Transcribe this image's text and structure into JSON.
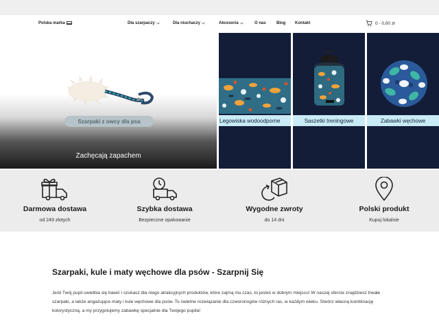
{
  "header": {
    "logo": "Polska marka",
    "nav": [
      {
        "label": "Dla szarpaczy",
        "has_dropdown": true
      },
      {
        "label": "Dla niuchaczy",
        "has_dropdown": true
      },
      {
        "label": "Akcesoria",
        "has_dropdown": true
      },
      {
        "label": "O nas",
        "has_dropdown": false
      },
      {
        "label": "Blog",
        "has_dropdown": false
      },
      {
        "label": "Kontakt",
        "has_dropdown": false
      }
    ],
    "cart_text": "0 - 0,00 zł"
  },
  "hero": {
    "pill_label": "Szarpaki z owcy dla psa",
    "caption": "Zachęcają zapachem"
  },
  "tiles": [
    {
      "label": "Legowiska wodoodporne"
    },
    {
      "label": "Saszetki treningowe"
    },
    {
      "label": "Zabawki węchowe"
    }
  ],
  "features": [
    {
      "title": "Darmowa dostawa",
      "subtitle": "od 249 złotych",
      "icon": "gift-truck-icon"
    },
    {
      "title": "Szybka dostawa",
      "subtitle": "Bezpieczne opakowanie",
      "icon": "fast-truck-icon"
    },
    {
      "title": "Wygodne zwroty",
      "subtitle": "do 14 dni",
      "icon": "return-box-icon"
    },
    {
      "title": "Polski produkt",
      "subtitle": "Kupuj lokalnie",
      "icon": "location-pin-icon"
    }
  ],
  "content": {
    "title": "Szarpaki, kule i maty węchowe dla psów - Szarpnij Się",
    "body": "Jeśli Twój pupil uwielbia się bawić i szukasz dla niego atrakcyjnych produktów, które zajmą mu czas, to jesteś w dobrym miejscu! W naszej ofercie znajdziesz trwałe szarpaki, a także angażujące maty i kule węchowe dla psów. To świetne rozwiązanie dla czworonogów różnych ras, w każdym wieku. Stwórz własną kombinację kolorystyczną, a my przygotujemy zabawkę specjalnie dla Twojego pupila!"
  },
  "colors": {
    "tile_bg": "#131d38",
    "tile_label_bg": "#c9ebf5",
    "features_bg": "#ececec",
    "pill_bg": "#b6c3c9"
  }
}
